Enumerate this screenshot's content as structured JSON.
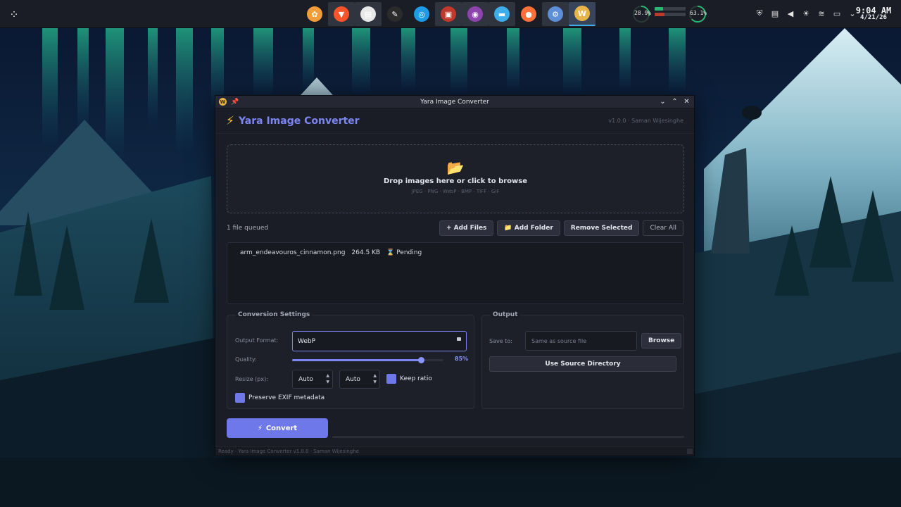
{
  "taskbar": {
    "apps": [
      {
        "icon": "flower-app-icon",
        "color": "#f39c3a",
        "glyph": "✿"
      },
      {
        "icon": "brave-browser-icon",
        "color": "#fb542b",
        "glyph": "▼"
      },
      {
        "icon": "text-editor-icon",
        "color": "#e8e8e8",
        "glyph": "▤"
      },
      {
        "icon": "notes-pen-icon",
        "color": "#2b2b2b",
        "glyph": "✎"
      },
      {
        "icon": "safari-compass-icon",
        "color": "#1d9be6",
        "glyph": "◎"
      },
      {
        "icon": "presentation-app-icon",
        "color": "#c0392b",
        "glyph": "▣"
      },
      {
        "icon": "disc-app-icon",
        "color": "#8e44ad",
        "glyph": "◉"
      },
      {
        "icon": "file-manager-icon",
        "color": "#3daee9",
        "glyph": "▬"
      },
      {
        "icon": "firefox-icon",
        "color": "#ff7139",
        "glyph": "●"
      },
      {
        "icon": "kde-settings-icon",
        "color": "#5c8fd6",
        "glyph": "⚙"
      },
      {
        "icon": "yara-app-icon",
        "color": "#e8b44a",
        "glyph": "W"
      }
    ],
    "cpu_percent": "28.9%",
    "cpu_fraction": 0.289,
    "mem_percent": "63.1%",
    "mem_fraction": 0.631,
    "clock_time": "9:04 AM",
    "clock_date": "4/21/26"
  },
  "window": {
    "title": "Yara Image Converter",
    "app_name": "Yara Image Converter",
    "version_credit": "v1.0.0 · Saman Wijesinghe"
  },
  "dropzone": {
    "icon": "folder-open-icon",
    "text": "Drop images here  or  click to browse",
    "formats": "JPEG · PNG · WebP · BMP · TIFF · GIF"
  },
  "queue": {
    "label": "1 file queued",
    "add_files": "+ Add Files",
    "add_folder": "📁 Add Folder",
    "remove_selected": "Remove Selected",
    "clear_all": "Clear All",
    "files": [
      {
        "name": "arm_endeavouros_cinnamon.png",
        "size": "264.5 KB",
        "status": "Pending"
      }
    ]
  },
  "conversion": {
    "title": "Conversion Settings",
    "format_label": "Output Format:",
    "format_value": "WebP",
    "quality_label": "Quality:",
    "quality_value": "85%",
    "quality_fraction": 0.85,
    "resize_label": "Resize (px):",
    "width_value": "Auto",
    "height_value": "Auto",
    "keep_ratio_label": "Keep ratio",
    "keep_ratio_checked": true,
    "exif_label": "Preserve EXIF metadata",
    "exif_checked": true
  },
  "output": {
    "title": "Output",
    "save_label": "Save to:",
    "save_placeholder": "Same as source file",
    "browse_label": "Browse",
    "use_source_label": "Use Source Directory"
  },
  "actions": {
    "convert_label": "Convert",
    "progress_fraction": 0
  },
  "statusbar": {
    "text": "Ready · Yara Image Converter v1.0.0 · Saman Wijesinghe"
  },
  "colors": {
    "accent": "#7c86f2",
    "window_bg": "#1b1d26",
    "panel_bg": "#1a1d26"
  }
}
